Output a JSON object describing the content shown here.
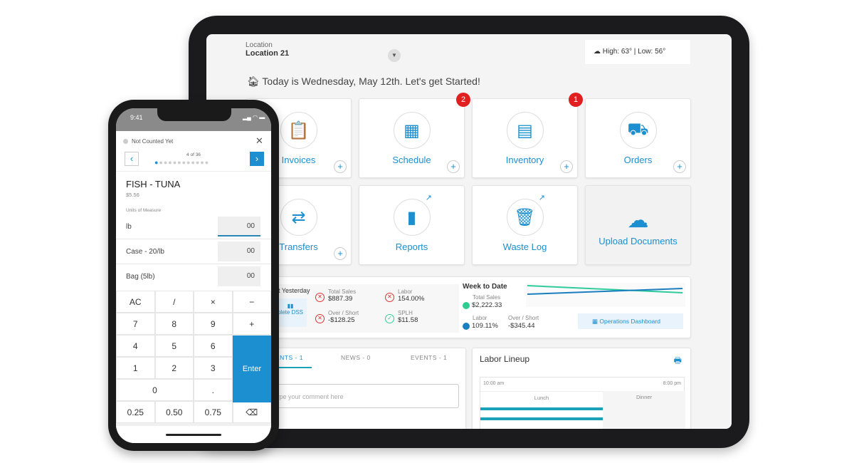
{
  "tablet": {
    "location_label": "Location",
    "location_value": "Location 21",
    "weather": "High: 63° | Low: 56°",
    "greeting": "Today is Wednesday, May 12th. Let's get Started!",
    "tiles": [
      {
        "label": "Invoices",
        "icon": "clipboard-icon",
        "glyph": "📋"
      },
      {
        "label": "Schedule",
        "icon": "calendar-icon",
        "glyph": "▦",
        "badge": "2"
      },
      {
        "label": "Inventory",
        "icon": "fridge-icon",
        "glyph": "▤",
        "badge": "1"
      },
      {
        "label": "Orders",
        "icon": "truck-icon",
        "glyph": "⛟"
      },
      {
        "label": "Transfers",
        "icon": "transfer-arrows-icon",
        "glyph": "⇄"
      },
      {
        "label": "Reports",
        "icon": "bar-chart-icon",
        "glyph": "▮"
      },
      {
        "label": "Waste Log",
        "icon": "trash-icon",
        "glyph": "🗑"
      },
      {
        "label": "Upload Documents",
        "icon": "cloud-upload-icon",
        "glyph": "☁"
      }
    ],
    "yesterday": {
      "title": "at Yesterday",
      "dss_label": "plete DSS",
      "total_sales_label": "Total Sales",
      "total_sales": "$887.39",
      "over_short_label": "Over / Short",
      "over_short": "-$128.25",
      "labor_label": "Labor",
      "labor": "154.00%",
      "splh_label": "SPLH",
      "splh": "$11.58"
    },
    "week": {
      "title": "Week to Date",
      "total_sales_label": "Total Sales",
      "total_sales": "$2,222.33",
      "labor_label": "Labor",
      "labor": "109.11%",
      "over_short_label": "Over / Short",
      "over_short": "-$345.44",
      "dashboard_button": "Operations Dashboard"
    },
    "tabs": [
      "ENTS - 1",
      "NEWS - 0",
      "EVENTS - 1"
    ],
    "comment_placeholder": "ype your comment here",
    "labor_lineup": {
      "title": "Labor Lineup",
      "start": "10:00 am",
      "end": "8:00 pm",
      "shifts": [
        "Lunch",
        "Dinner"
      ]
    },
    "colors": {
      "accent": "#1b8fcf",
      "badge": "#e02020",
      "green": "#2ecc8f",
      "teal": "#1aa3b8"
    }
  },
  "phone": {
    "time": "9:41",
    "status": "Not Counted Yet",
    "counter": "4 of 36",
    "item": "FISH - TUNA",
    "price": "$5.56",
    "uom_label": "Units of Measure",
    "uoms": [
      {
        "name": "lb",
        "value": "00"
      },
      {
        "name": "Case - 20/lb",
        "value": "00"
      },
      {
        "name": "Bag (5lb)",
        "value": "00"
      }
    ],
    "keys": [
      "AC",
      "/",
      "×",
      "−",
      "7",
      "8",
      "9",
      "+",
      "4",
      "5",
      "6",
      "1",
      "2",
      "3",
      "0",
      ".",
      "0.25",
      "0.50",
      "0.75",
      "⌫"
    ],
    "enter": "Enter"
  }
}
